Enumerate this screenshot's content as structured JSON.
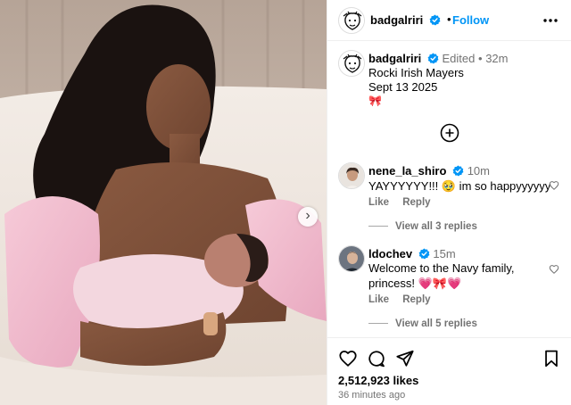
{
  "post": {
    "author": "badgalriri",
    "follow_label": "Follow",
    "separator": "•",
    "carousel_next_glyph": "›"
  },
  "caption": {
    "author": "badgalriri",
    "edited_label": "Edited",
    "meta_sep": "•",
    "age": "32m",
    "line1": "Rocki Irish Mayers",
    "line2": "Sept 13 2025",
    "emoji": "🎀"
  },
  "comments": [
    {
      "user": "nene_la_shiro",
      "age": "10m",
      "text": "YAYYYYYY!!! 🥹 im so happyyyyyy",
      "like_label": "Like",
      "reply_label": "Reply",
      "replies_label": "View all 3 replies"
    },
    {
      "user": "ldochev",
      "age": "15m",
      "text": "Welcome to the Navy family, princess! 💗🎀💗",
      "like_label": "Like",
      "reply_label": "Reply",
      "replies_label": "View all 5 replies"
    }
  ],
  "stats": {
    "likes": "2,512,923 likes",
    "posted": "36 minutes ago"
  },
  "icons": {
    "like": "heart-icon",
    "comment": "comment-bubble-icon",
    "share": "paper-plane-icon",
    "save": "bookmark-icon",
    "verified": "verified-badge-icon",
    "more": "ellipsis-icon",
    "add": "plus-circle-icon"
  },
  "colors": {
    "link_blue": "#0095f6",
    "verified_blue": "#0095f6",
    "muted_text": "#737373",
    "divider": "#efefef"
  }
}
